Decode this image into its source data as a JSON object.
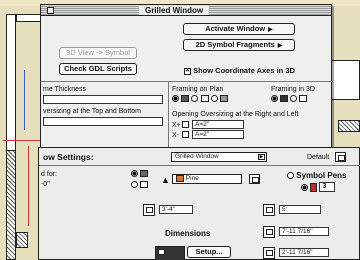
{
  "grilled_window": {
    "title": "Grilled Window",
    "activate_label": "Activate Window",
    "symbol_fragments_label": "2D Symbol Fragments",
    "view_symbol_label": "3D View -> Symbol",
    "check_gdl_label": "Check GDL Scripts",
    "show_axes_label": "Show Coordinate Axes in 3D",
    "show_axes_checked": true,
    "frame_thickness_label": "me Thickness",
    "oversizing_top_bottom_label": "versizing at the Top and Bottom",
    "framing_on_plan_label": "Framing on Plan",
    "framing_in_3d_label": "Framing in 3D",
    "oversizing_lr_label": "Opening Oversizing at the Right and Left",
    "x_plus_label": "X+",
    "x_minus_label": "X-",
    "x_plus_value": "A=2\"",
    "x_minus_value": "A=2\""
  },
  "settings": {
    "title": "ow Settings:",
    "object_name": "Grilled Window",
    "default_label": "Default",
    "used_for_label": "d for:",
    "dim_label": "-0\"",
    "material_label": "Pine",
    "material_color": "#e0742a",
    "symbol_pens_label": "Symbol Pens",
    "pen_number": "3",
    "pen_color": "#d32626",
    "width_value": "3'-4\"",
    "height_value": "5'",
    "dimensions_label": "Dimensions",
    "setup_label": "Setup...",
    "elev_value_1": "7'-11 7/16\"",
    "elev_value_2": "2'-11 7/16\""
  },
  "icons": {
    "close": "close-box-icon",
    "dropdown": "triangle-right-icon",
    "pen": "pen-icon"
  }
}
